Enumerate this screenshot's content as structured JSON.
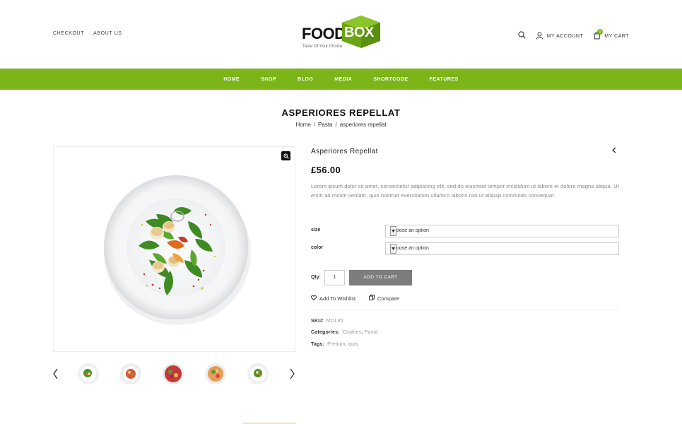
{
  "header": {
    "top_links": [
      "CHECKOUT",
      "ABOUT US"
    ],
    "logo_food": "FOOD",
    "logo_box": "BOX",
    "logo_tagline": "Taste Of Your Choice",
    "account_label": "MY ACCOUNT",
    "cart_label": "MY CART",
    "cart_count": "0"
  },
  "nav": {
    "items": [
      "HOME",
      "SHOP",
      "BLOG",
      "MEDIA",
      "SHORTCODE",
      "FEATURES"
    ]
  },
  "page": {
    "title": "ASPERIORES REPELLAT",
    "breadcrumb": [
      "Home",
      "Pasta",
      "asperiores repellat"
    ]
  },
  "product": {
    "name": "Asperiores Repellat",
    "price": "£56.00",
    "description": "Lorem ipsum dolor sit amet, consectetur adipiscing elit, sed do eiusmod tempor incididunt ut labore et dolore magna aliqua. Ut enim ad minim veniam, quis nostrud exercitation ullamco laboris nisi ut aliquip commodo consequat.",
    "size_label": "size",
    "size_placeholder": "Choose an option",
    "color_label": "color",
    "color_placeholder": "Choose an option",
    "qty_label": "Qty:",
    "qty_value": "1",
    "add_to_cart": "ADD TO CART",
    "wishlist": "Add To Wishlist",
    "compare": "Compare",
    "sku_label": "SKU:",
    "sku_value": "MOL85",
    "categories_label": "Categories:",
    "categories": [
      "Cookies",
      "Pasta"
    ],
    "tags_label": "Tags:",
    "tags": [
      "Pretium",
      "quis"
    ]
  },
  "colors": {
    "accent": "#7cb518",
    "button_grey": "#7d7d7d"
  }
}
